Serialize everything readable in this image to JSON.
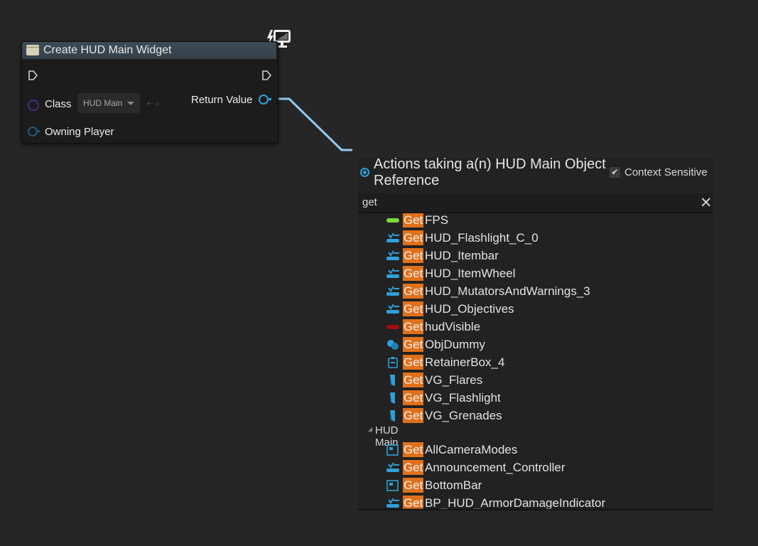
{
  "node": {
    "title": "Create HUD Main Widget",
    "class_label": "Class",
    "class_value": "HUD Main",
    "owning_player_label": "Owning Player",
    "return_value_label": "Return Value"
  },
  "menu": {
    "title": "Actions taking a(n) HUD Main Object Reference",
    "context_sensitive_label": "Context Sensitive",
    "context_sensitive_checked": true,
    "checkbox_glyph": "✔",
    "search_value": "get",
    "clear_glyph": "✕",
    "highlight": "Get",
    "items_top": [
      {
        "label": "FPS",
        "icon": "bool-var-icon"
      },
      {
        "label": "HUD_Flashlight_C_0",
        "icon": "widget-var-icon"
      },
      {
        "label": "HUD_Itembar",
        "icon": "widget-var-icon"
      },
      {
        "label": "HUD_ItemWheel",
        "icon": "widget-var-icon"
      },
      {
        "label": "HUD_MutatorsAndWarnings_3",
        "icon": "widget-var-icon"
      },
      {
        "label": "HUD_Objectives",
        "icon": "widget-var-icon"
      },
      {
        "label": "hudVisible",
        "icon": "bool-false-var-icon"
      },
      {
        "label": "ObjDummy",
        "icon": "object-var-icon"
      },
      {
        "label": "RetainerBox_4",
        "icon": "retainer-box-icon"
      },
      {
        "label": "VG_Flares",
        "icon": "vertical-box-icon"
      },
      {
        "label": "VG_Flashlight",
        "icon": "vertical-box-icon"
      },
      {
        "label": "VG_Grenades",
        "icon": "vertical-box-icon"
      }
    ],
    "category": "HUD Main",
    "items_bottom": [
      {
        "label": "AllCameraModes",
        "icon": "canvas-panel-icon"
      },
      {
        "label": "Announcement_Controller",
        "icon": "widget-var-icon"
      },
      {
        "label": "BottomBar",
        "icon": "canvas-panel-icon"
      },
      {
        "label": "BP_HUD_ArmorDamageIndicator",
        "icon": "widget-var-icon"
      }
    ]
  },
  "colors": {
    "highlight": "#e0711c",
    "object_pin": "#2fa0d8",
    "class_pin": "#4a2a86"
  }
}
